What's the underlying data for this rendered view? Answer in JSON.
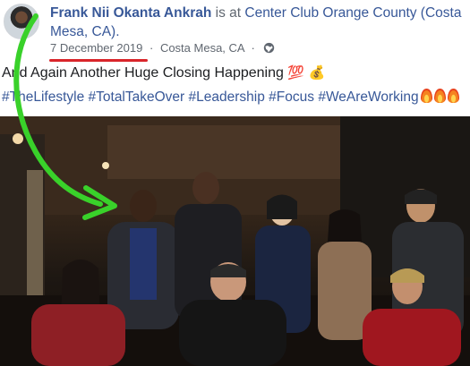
{
  "post": {
    "author": "Frank Nii Okanta Ankrah",
    "verb": "is at",
    "location": "Center Club Orange County (Costa Mesa, CA).",
    "date": "7 December 2019",
    "separator": "·",
    "place": "Costa Mesa, CA",
    "text": "And Again Another Huge Closing Happening",
    "emoji_1": "💯",
    "emoji_2": "💰",
    "hashtags": [
      "#TheLifestyle",
      "#TotalTakeOver",
      "#Leadership",
      "#Focus",
      "#WeAreWorking"
    ]
  },
  "icons": {
    "privacy": "globe-icon",
    "flame": "fire-icon"
  },
  "colors": {
    "link": "#385898",
    "secondary_text": "#606770",
    "annotation_arrow": "#39d12a",
    "annotation_underline": "#d9252a"
  }
}
